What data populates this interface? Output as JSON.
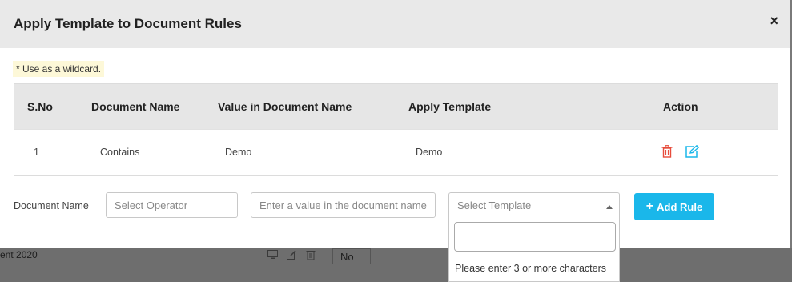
{
  "background": {
    "row_text": "ent 2020",
    "select_value": "No"
  },
  "modal": {
    "title": "Apply Template to Document Rules",
    "close_label": "×",
    "note": "* Use as a wildcard.",
    "table": {
      "headers": [
        "S.No",
        "Document Name",
        "Value in Document Name",
        "Apply Template",
        "Action"
      ],
      "rows": [
        {
          "sno": "1",
          "document_name": "Contains",
          "value": "Demo",
          "template": "Demo"
        }
      ]
    },
    "form": {
      "label": "Document Name",
      "operator_placeholder": "Select Operator",
      "value_placeholder": "Enter a value in the document name",
      "template_placeholder": "Select Template",
      "add_rule_label": "Add Rule"
    },
    "dropdown": {
      "message": "Please enter 3 or more characters"
    }
  },
  "colors": {
    "accent": "#1ab7ea",
    "delete": "#e74c3c",
    "edit": "#1ab7ea"
  }
}
